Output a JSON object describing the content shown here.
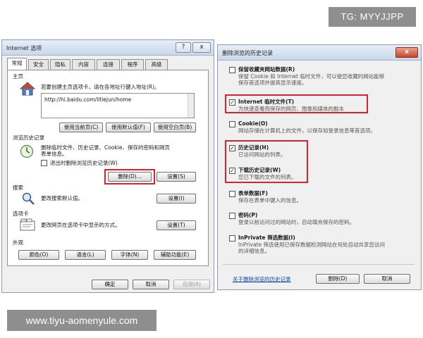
{
  "watermarks": {
    "top": "TG: MYYJJPP",
    "bottom": "www.tiyu-aomenyule.com"
  },
  "internet_options": {
    "title": "Internet 选项",
    "help_glyph": "?",
    "close_glyph": "x",
    "tabs": [
      "常规",
      "安全",
      "隐私",
      "内容",
      "连接",
      "程序",
      "高级"
    ],
    "active_tab": 0,
    "home": {
      "heading": "主页",
      "description": "若要创建主页选项卡，请在各地址行键入地址(R)。",
      "url": "http://hi.baidu.com/litiejun/home",
      "btn_current": "使用当前页(C)",
      "btn_default": "使用默认值(F)",
      "btn_blank": "使用空白页(B)"
    },
    "history": {
      "heading": "浏览历史记录",
      "description_line1": "删除临时文件、历史记录、Cookie、保存的密码和网页",
      "description_line2": "表单信息。",
      "exit_delete_label": "退出时删除浏览历史记录(W)",
      "exit_delete_checked": false,
      "btn_delete": "删除(D)...",
      "btn_settings": "设置(S)"
    },
    "search": {
      "heading": "搜索",
      "description": "更改搜索默认值。",
      "btn_settings": "设置(I)"
    },
    "tabs_section": {
      "heading": "选项卡",
      "description": "更改网页在选项卡中显示的方式。",
      "btn_settings": "设置(T)"
    },
    "appearance": {
      "heading": "外观",
      "btn_colors": "颜色(O)",
      "btn_languages": "语言(L)",
      "btn_fonts": "字体(N)",
      "btn_accessibility": "辅助功能(E)"
    },
    "footer": {
      "ok": "确定",
      "cancel": "取消",
      "apply": "应用(A)"
    }
  },
  "delete_history": {
    "title": "删除浏览的历史记录",
    "close_glyph": "x",
    "items": [
      {
        "label": "保留收藏夹网站数据(R)",
        "desc1": "保留 Cookie 和 Internet 临时文件，可以使您收藏的网站能够",
        "desc2": "保存首选项并提高显示速度。",
        "checked": false
      },
      {
        "label": "Internet 临时文件(T)",
        "desc1": "为快速查看而保存的网页、图像和媒体的副本",
        "desc2": "",
        "checked": true
      },
      {
        "label": "Cookie(O)",
        "desc1": "网站存储在计算机上的文件，以保存如登录信息等首选项。",
        "desc2": "",
        "checked": false
      },
      {
        "label": "历史记录(H)",
        "desc1": "已访问网站的列表。",
        "desc2": "",
        "checked": true
      },
      {
        "label": "下载历史记录(W)",
        "desc1": "您已下载的文件的列表。",
        "desc2": "",
        "checked": true
      },
      {
        "label": "表单数据(F)",
        "desc1": "保存在表单中键入的信息。",
        "desc2": "",
        "checked": false
      },
      {
        "label": "密码(P)",
        "desc1": "登录以前访问过的网站时，自动填充保存的密码。",
        "desc2": "",
        "checked": false
      },
      {
        "label": "InPrivate 筛选数据(I)",
        "desc1": "InPrivate 筛选使用已保存数据检测网站在何处自动共享您访问",
        "desc2": "的详细信息。",
        "checked": false
      }
    ],
    "link": "关于删除浏览的历史记录",
    "btn_delete": "删除(D)",
    "btn_cancel": "取消"
  },
  "colors": {
    "highlight": "#d9232d",
    "link": "#0a46c8"
  },
  "icons": [
    "house-icon",
    "history-clock-icon",
    "magnifier-icon",
    "tabs-window-icon",
    "checkmark-icon"
  ]
}
